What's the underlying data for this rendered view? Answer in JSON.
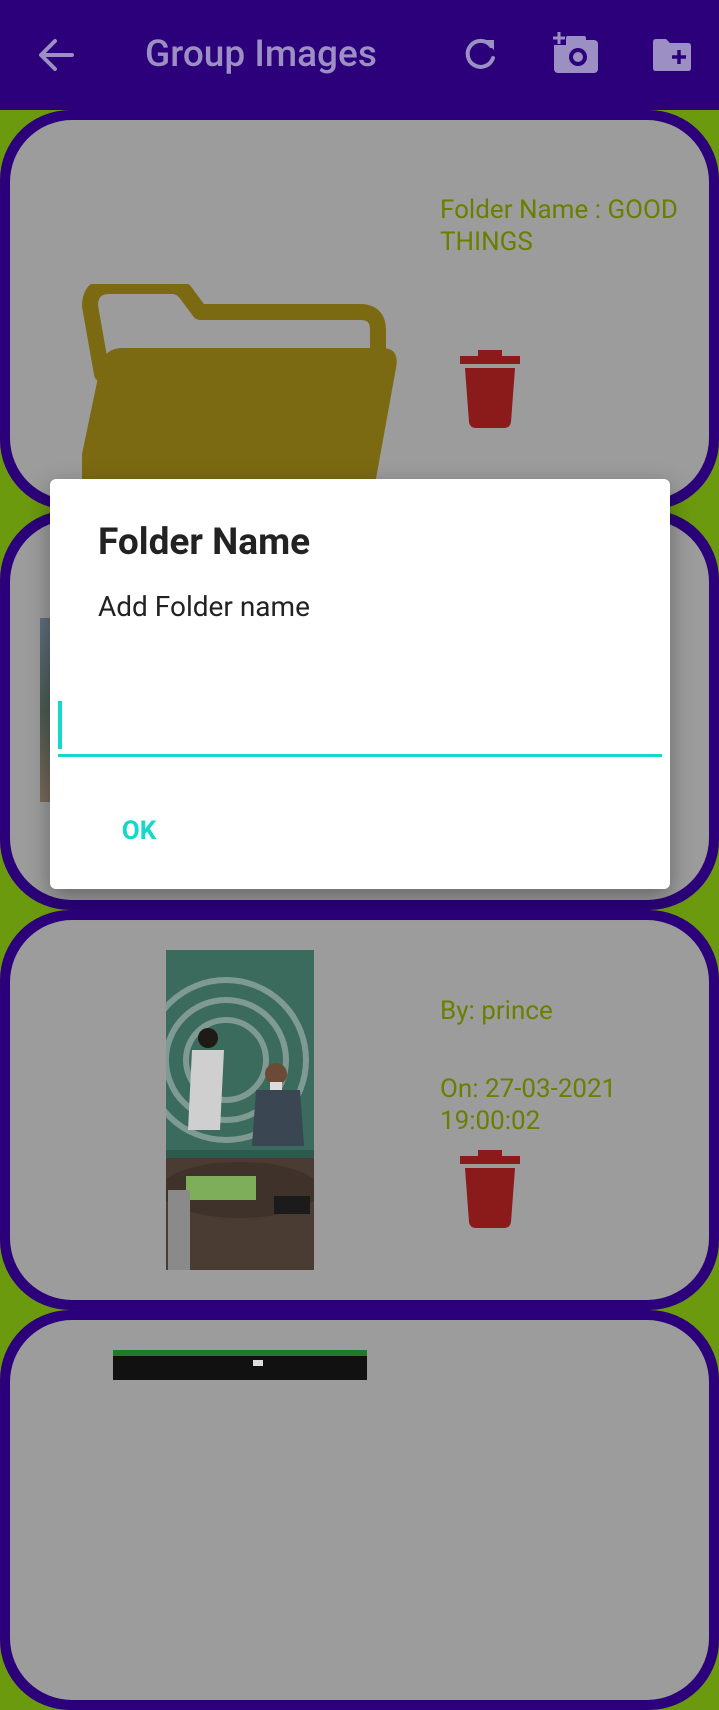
{
  "appbar": {
    "title": "Group Images",
    "icons": [
      "back-arrow-icon",
      "refresh-icon",
      "add-photo-icon",
      "create-folder-icon"
    ]
  },
  "cards": [
    {
      "type": "folder",
      "folder_label": "Folder Name : GOOD THINGS"
    },
    {
      "type": "image"
    },
    {
      "type": "image",
      "by": "By: prince",
      "on": "On: 27-03-2021 19:00:02"
    },
    {
      "type": "image"
    }
  ],
  "dialog": {
    "title": "Folder Name",
    "message": "Add Folder name",
    "input_value": "",
    "ok_label": "OK"
  },
  "colors": {
    "appbar": "#2b007a",
    "accent": "#14d8c8",
    "delete": "#8b1a1a",
    "folder": "#7c6a12",
    "text_green": "#6a7f00"
  }
}
